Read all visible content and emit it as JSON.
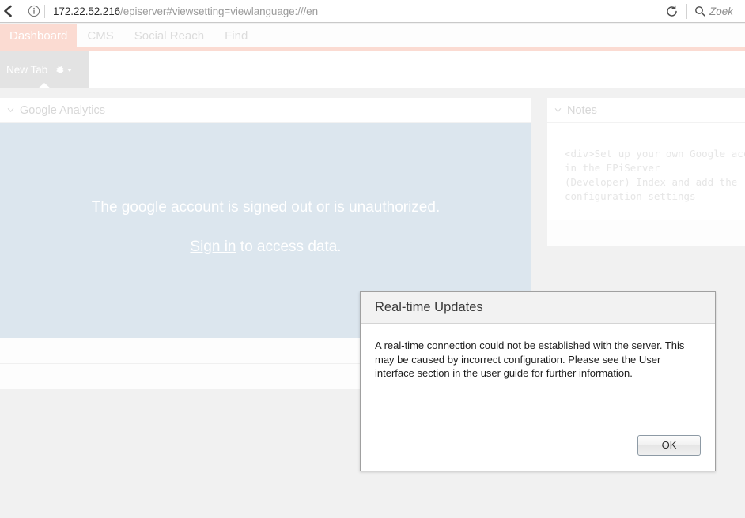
{
  "browser": {
    "back_icon": "back-arrow-icon",
    "info_icon": "info-circle-icon",
    "url_host": "172.22.52.216",
    "url_rest": "/episerver#viewsetting=viewlanguage:///en",
    "url_full": "172.22.52.216/episerver#viewsetting=viewlanguage:///en",
    "reload_icon": "reload-icon",
    "search_icon": "search-icon",
    "search_placeholder": "Zoek"
  },
  "global_nav": {
    "items": [
      {
        "label": "Dashboard",
        "active": true
      },
      {
        "label": "CMS",
        "active": false
      },
      {
        "label": "Social Reach",
        "active": false
      },
      {
        "label": "Find",
        "active": false
      }
    ],
    "accent_color": "#fbdbd2"
  },
  "tab_strip": {
    "tab_label": "New Tab",
    "gear_icon": "gear-icon",
    "caret_icon": "chevron-down-icon"
  },
  "gadgets": {
    "google_analytics": {
      "title": "Google Analytics",
      "collapse_icon": "chevron-down-icon",
      "message": "The google account is signed out or is unauthorized.",
      "signin_link": "Sign in",
      "signin_suffix": " to access data.",
      "body_color": "#dce6ee"
    },
    "notes": {
      "title": "Notes",
      "collapse_icon": "chevron-down-icon",
      "text": "<div>Set up your own Google account in the EPiServer\n(Developer) Index and add the configuration settings"
    }
  },
  "dialog": {
    "title": "Real-time Updates",
    "message": "A real-time connection could not be established with the server. This may be caused by incorrect configuration. Please see the User interface section in the user guide for further information.",
    "ok_label": "OK"
  }
}
